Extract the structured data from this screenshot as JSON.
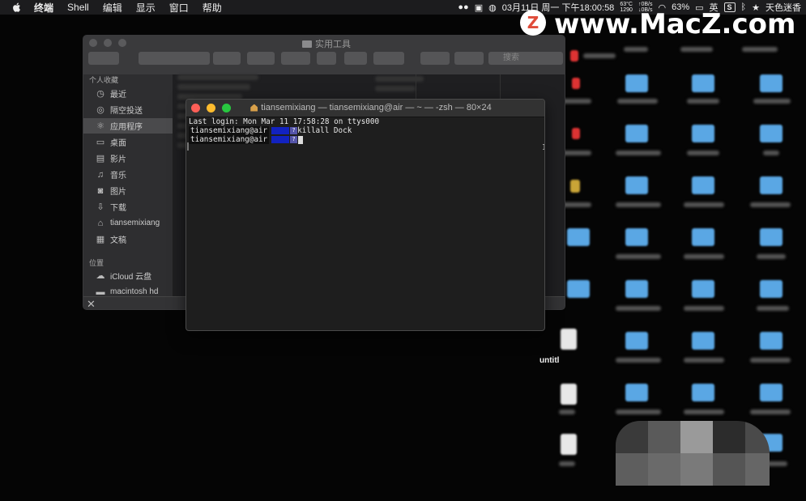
{
  "menubar": {
    "items": [
      "终端",
      "Shell",
      "编辑",
      "显示",
      "窗口",
      "帮助"
    ],
    "temp_top": "63°C",
    "temp_bottom": "1290",
    "net_up": "↑0B/s",
    "net_down": "↓0B/s",
    "datetime": "03月11日 周一 下午18:00:58",
    "battery": "63%",
    "input_method": "英",
    "user": "天色迷香"
  },
  "watermark": {
    "logo_letter": "Z",
    "text": "www.MacZ.com"
  },
  "finder": {
    "title": "实用工具",
    "search_placeholder": "搜索",
    "favorites_header": "个人收藏",
    "favorites": [
      {
        "icon": "clock-icon",
        "label": "最近"
      },
      {
        "icon": "airdrop-icon",
        "label": "隔空投送"
      },
      {
        "icon": "applications-icon",
        "label": "应用程序"
      },
      {
        "icon": "desktop-icon",
        "label": "桌面"
      },
      {
        "icon": "movies-icon",
        "label": "影片"
      },
      {
        "icon": "music-icon",
        "label": "音乐"
      },
      {
        "icon": "pictures-icon",
        "label": "图片"
      },
      {
        "icon": "downloads-icon",
        "label": "下载"
      },
      {
        "icon": "home-icon",
        "label": "tiansemixiang"
      },
      {
        "icon": "documents-icon",
        "label": "文稿"
      }
    ],
    "locations_header": "位置",
    "locations": [
      {
        "icon": "cloud-icon",
        "label": "iCloud 云盘"
      },
      {
        "icon": "disk-icon",
        "label": "macintosh hd"
      }
    ]
  },
  "terminal": {
    "title": "tiansemixiang — tiansemixiang@air — ~ — -zsh — 80×24",
    "last_login": "Last login: Mon Mar 11 17:58:28 on ttys000",
    "prompt_user": "tiansemixiang@air",
    "prompt_mark": "?",
    "command": "killall Dock"
  },
  "desktop": {
    "file_label": "untitl"
  },
  "colors": {
    "close": "#fd5f57",
    "minimize": "#febc2e",
    "zoom": "#28c840",
    "prompt_segment": "#1222c0",
    "folder_blue": "#5aa7e4"
  }
}
